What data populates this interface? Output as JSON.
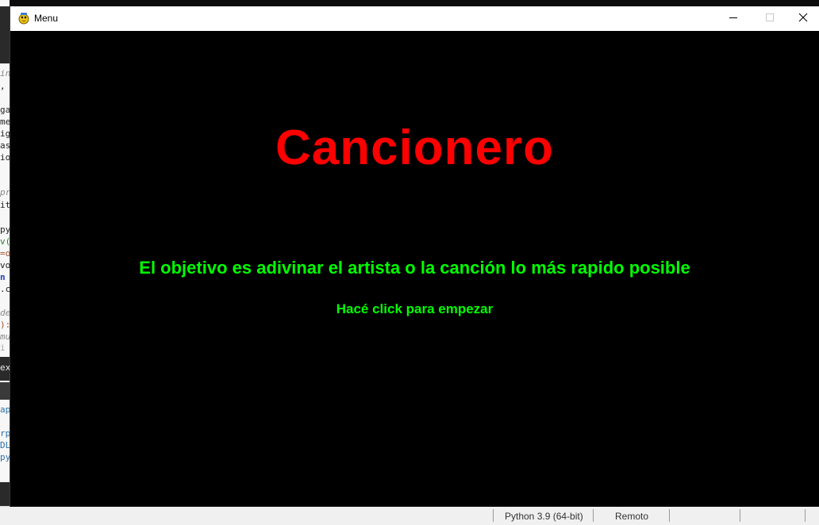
{
  "window": {
    "title": "Menu",
    "app_icon": "python-snake-icon",
    "controls": {
      "minimize_icon": "minimize-icon",
      "maximize_icon": "maximize-icon",
      "close_icon": "close-icon"
    }
  },
  "game": {
    "title": "Cancionero",
    "subtitle": "El objetivo es adivinar el artista o la canción lo más rapido posible",
    "hint": "Hacé click para empezar",
    "colors": {
      "background": "#000000",
      "title": "#ff0000",
      "text": "#00ff00"
    }
  },
  "status_bar": {
    "interpreter": "Python 3.9 (64-bit)",
    "mode": "Remoto"
  },
  "background_editor": {
    "lines": [
      "in",
      ",",
      "",
      "ga",
      "me",
      "ig",
      "as",
      "io",
      "",
      "",
      "pr",
      "it",
      "",
      "py",
      "v(",
      "=o",
      "vo",
      "n",
      ".c",
      "",
      "de",
      "):",
      "mu",
      "i"
    ],
    "panel_tab": "ex",
    "lower_lines": [
      "apa",
      "",
      "rpr",
      "DL",
      "py"
    ]
  }
}
